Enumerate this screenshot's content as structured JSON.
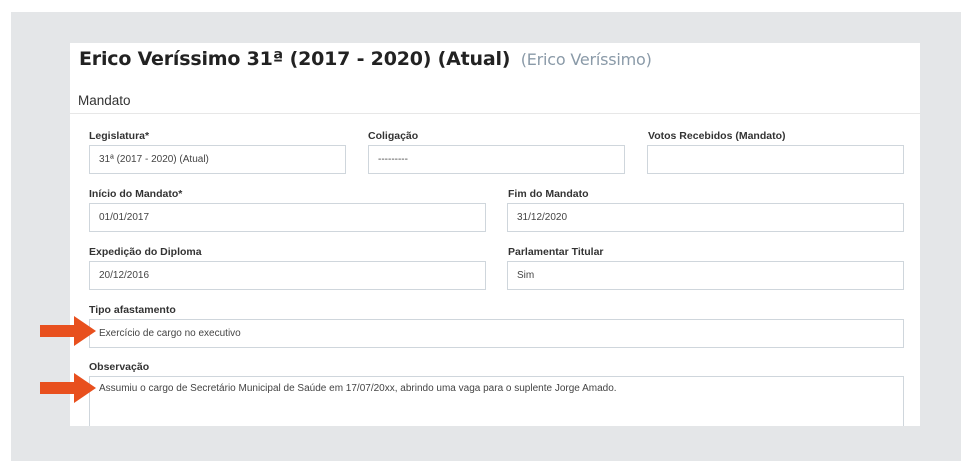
{
  "header": {
    "title": "Erico Veríssimo 31ª (2017 - 2020) (Atual)",
    "subtitle": "(Erico Veríssimo)"
  },
  "section": {
    "title": "Mandato"
  },
  "fields": {
    "legislatura": {
      "label": "Legislatura*",
      "value": "31ª (2017 - 2020) (Atual)"
    },
    "coligacao": {
      "label": "Coligação",
      "value": "---------"
    },
    "votos": {
      "label": "Votos Recebidos (Mandato)",
      "value": ""
    },
    "inicio": {
      "label": "Início do Mandato*",
      "value": "01/01/2017"
    },
    "fim": {
      "label": "Fim do Mandato",
      "value": "31/12/2020"
    },
    "expedicao": {
      "label": "Expedição do Diploma",
      "value": "20/12/2016"
    },
    "parlamentar": {
      "label": "Parlamentar Titular",
      "value": "Sim"
    },
    "afastamento": {
      "label": "Tipo afastamento",
      "value": "Exercício de cargo no executivo"
    },
    "observacao": {
      "label": "Observação",
      "value": "Assumiu o cargo de Secretário Municipal de Saúde em 17/07/20xx, abrindo uma vaga para o suplente Jorge Amado."
    }
  },
  "colors": {
    "arrow": "#e8501e",
    "frame": "#e4e6e8",
    "border": "#cfd6dc"
  },
  "icons": [
    "arrow-right-icon"
  ]
}
